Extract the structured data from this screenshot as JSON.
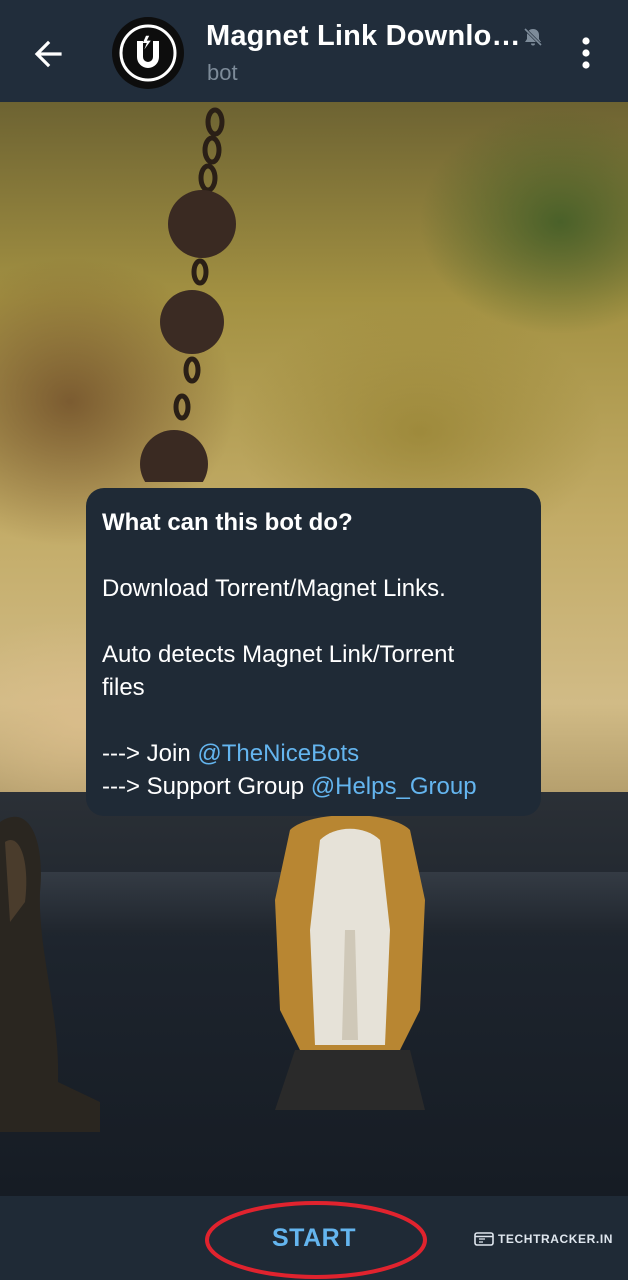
{
  "header": {
    "back_icon": "arrow-left-icon",
    "avatar_icon": "magnet-icon",
    "title": "Magnet Link Downlo…",
    "mute_icon": "bell-muted-icon",
    "subtitle": "bot",
    "menu_icon": "more-vertical-icon"
  },
  "bubble": {
    "heading": "What can this bot do?",
    "line1": "Download Torrent/Magnet Links.",
    "line2a": "Auto detects Magnet Link/Torrent",
    "line2b": "files",
    "join_prefix": "---> Join ",
    "join_link": "@TheNiceBots",
    "support_prefix": "---> Support Group ",
    "support_link": "@Helps_Group"
  },
  "bottom": {
    "start_label": "START"
  },
  "watermark": {
    "text": "TECHTRACKER.IN"
  },
  "colors": {
    "header_bg": "#212d3b",
    "bubble_bg": "#1f2a36",
    "link": "#64b5ef",
    "annotation_ring": "#e0232e"
  }
}
